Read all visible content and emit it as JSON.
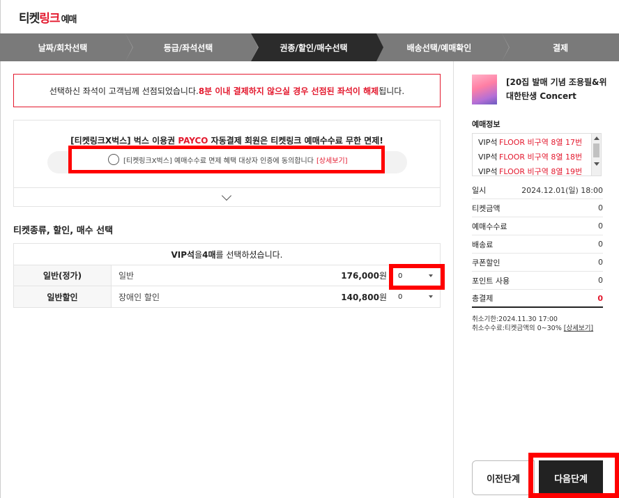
{
  "header": {
    "logo_part1": "티켓",
    "logo_part2": "링크",
    "logo_part3": "예매"
  },
  "steps": [
    {
      "label": "날짜/회차선택",
      "active": false
    },
    {
      "label": "등급/좌석선택",
      "active": false
    },
    {
      "label": "권종/할인/매수선택",
      "active": true
    },
    {
      "label": "배송선택/예매확인",
      "active": false
    },
    {
      "label": "결제",
      "active": false
    }
  ],
  "notice": {
    "text1": "선택하신 좌석이 고객님께 선점되었습니다. ",
    "text_red": "8분 이내 결제하지 않으실 경우 선점된 좌석이 해제",
    "text2": "됩니다."
  },
  "promo": {
    "title1": "[티켓링크X벅스] 벅스 이용권 ",
    "title_payco": "PAYCO",
    "title2": " 자동결제 회원은 티켓링크 예매수수료 무한 면제!",
    "agree_text": "[티켓링크X벅스] 예매수수료 면제 혜택 대상자 인증에 동의합니다",
    "detail_link": "[상세보기]"
  },
  "ticket_section": {
    "title": "티켓종류, 할인, 매수 선택",
    "header_grade": "VIP석",
    "header_mid": "을 ",
    "header_count": "4매",
    "header_tail": "를 선택하셨습니다.",
    "rows": [
      {
        "type": "일반(정가)",
        "desc": "일반",
        "price": "176,000",
        "unit": "원",
        "qty": "0"
      },
      {
        "type": "일반할인",
        "desc": "장애인 할인",
        "price": "140,800",
        "unit": "원",
        "qty": "0"
      }
    ]
  },
  "summary": {
    "show_title": "[20집 발매 기념 조용필&위대한탄생 Concert",
    "info_title": "예매정보",
    "seats": [
      {
        "grade": "VIP석",
        "loc": "FLOOR 비구역 8열 17번"
      },
      {
        "grade": "VIP석",
        "loc": "FLOOR 비구역 8열 18번"
      },
      {
        "grade": "VIP석",
        "loc": "FLOOR 비구역 8열 19번"
      }
    ],
    "fees": [
      {
        "label": "일시",
        "value": "2024.12.01(일) 18:00"
      },
      {
        "label": "티켓금액",
        "value": "0"
      },
      {
        "label": "예매수수료",
        "value": "0"
      },
      {
        "label": "배송료",
        "value": "0"
      },
      {
        "label": "쿠폰할인",
        "value": "0"
      },
      {
        "label": "포인트 사용",
        "value": "0"
      }
    ],
    "total_label": "총결제",
    "total_value": "0",
    "cancel_deadline": "취소기한:2024.11.30 17:00",
    "cancel_fee": "취소수수료:티켓금액의 0~30% ",
    "cancel_detail": "[상세보기]",
    "prev_button": "이전단계",
    "next_button": "다음단계"
  }
}
